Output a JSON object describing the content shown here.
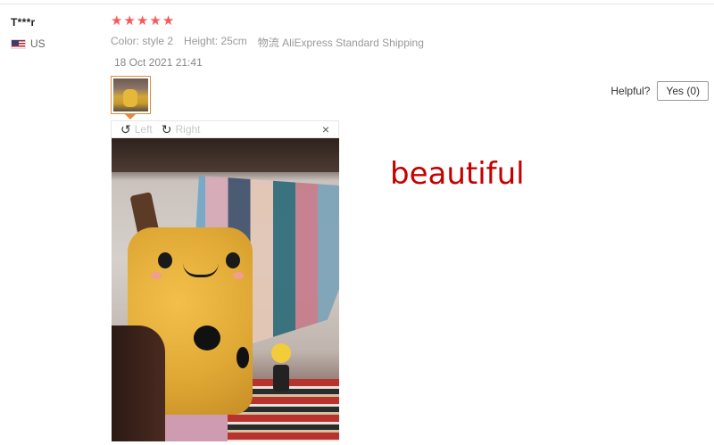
{
  "reviewer": {
    "name": "T***r",
    "country": "US"
  },
  "review": {
    "rating": 5,
    "stars": [
      "★",
      "★",
      "★",
      "★",
      "★"
    ],
    "color_label": "Color:",
    "color_value": "style 2",
    "height_label": "Height:",
    "height_value": "25cm",
    "shipping_label": "物流",
    "shipping_value": "AliExpress Standard Shipping",
    "date": "18 Oct 2021 21:41",
    "text": "beautiful"
  },
  "viewer": {
    "rotate_left_icon": "↺",
    "rotate_left_label": "Left",
    "rotate_right_icon": "↻",
    "rotate_right_label": "Right",
    "close_icon": "×"
  },
  "helpful": {
    "label": "Helpful?",
    "yes_label": "Yes (0)"
  },
  "colors": {
    "star": "#f65a5a",
    "review_text": "#c40000",
    "thumb_border": "#e08a3a"
  }
}
